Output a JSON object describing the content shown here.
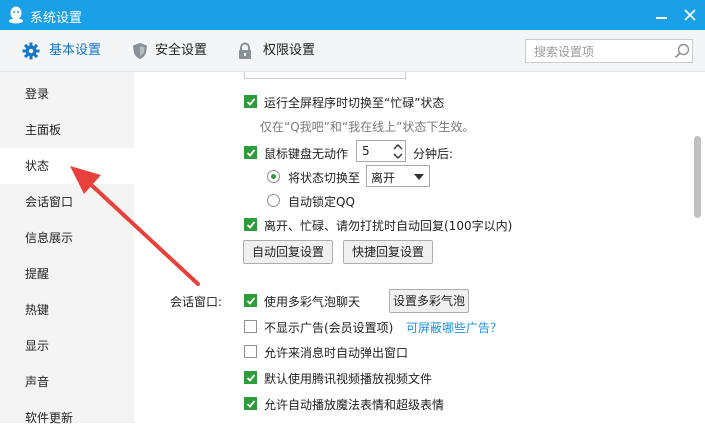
{
  "window": {
    "title": "系统设置",
    "accent_color": "#1aa0e6"
  },
  "toolbar": {
    "tabs": [
      {
        "label": "基本设置",
        "icon": "gear-icon",
        "active": true
      },
      {
        "label": "安全设置",
        "icon": "shield-icon",
        "active": false
      },
      {
        "label": "权限设置",
        "icon": "lock-icon",
        "active": false
      }
    ],
    "search_placeholder": "搜索设置项"
  },
  "sidebar": {
    "items": [
      {
        "label": "登录"
      },
      {
        "label": "主面板"
      },
      {
        "label": "状态",
        "selected": true
      },
      {
        "label": "会话窗口"
      },
      {
        "label": "信息展示"
      },
      {
        "label": "提醒"
      },
      {
        "label": "热键"
      },
      {
        "label": "显示"
      },
      {
        "label": "声音"
      },
      {
        "label": "软件更新"
      }
    ]
  },
  "status_section": {
    "fullscreen_busy": {
      "label": "运行全屏程序时切换至“忙碌”状态",
      "checked": true
    },
    "fullscreen_hint": "仅在“Q我吧”和“我在线上”状态下生效。",
    "idle": {
      "label": "鼠标键盘无动作",
      "checked": true,
      "minutes_value": "5",
      "unit_label": "分钟后:"
    },
    "switch_status": {
      "label": "将状态切换至",
      "selected": true,
      "value": "离开"
    },
    "auto_lock": {
      "label": "自动锁定QQ",
      "selected": false
    },
    "auto_reply": {
      "label": "离开、忙碌、请勿打扰时自动回复(100字以内)",
      "checked": true
    },
    "auto_reply_button": "自动回复设置",
    "quick_reply_button": "快捷回复设置"
  },
  "session_section": {
    "heading": "会话窗口:",
    "colorful_bubble": {
      "label": "使用多彩气泡聊天",
      "checked": true
    },
    "bubble_button": "设置多彩气泡",
    "hide_ads": {
      "label": "不显示广告(会员设置项)",
      "checked": false
    },
    "ads_link": "可屏蔽哪些广告？",
    "popup_on_message": {
      "label": "允许来消息时自动弹出窗口",
      "checked": false
    },
    "tencent_video": {
      "label": "默认使用腾讯视频播放视频文件",
      "checked": true
    },
    "magic_emoticons": {
      "label": "允许自动播放魔法表情和超级表情",
      "checked": true
    }
  },
  "colors": {
    "checkbox_on": "#2f9c3b",
    "link": "#1e8fd8",
    "annotation_arrow": "#e8403a"
  }
}
